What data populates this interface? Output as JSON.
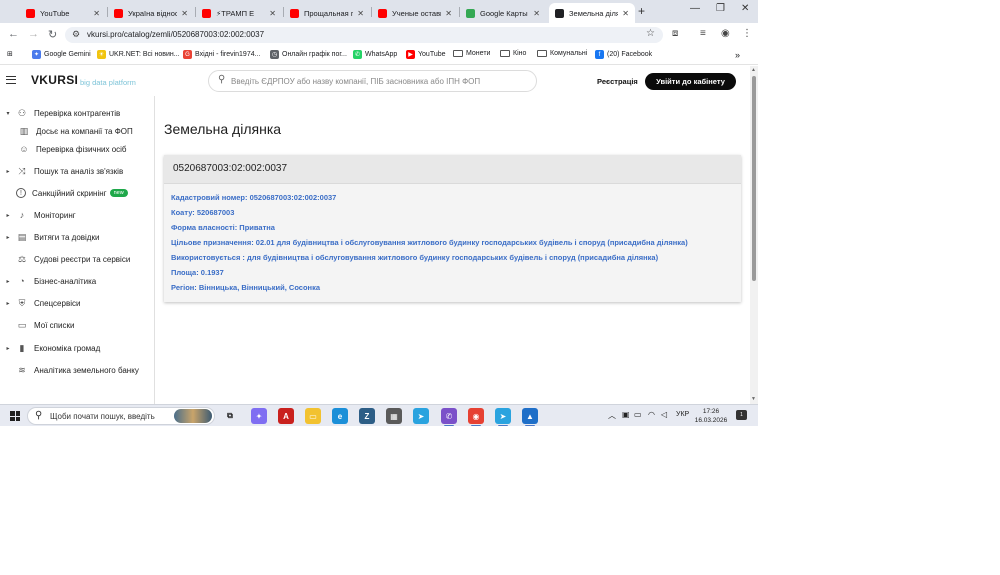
{
  "browser": {
    "tabs": [
      {
        "title": "YouTube",
        "color": "#ff0000",
        "active": false
      },
      {
        "title": "Україна відносл",
        "color": "#ff0000",
        "active": false
      },
      {
        "title": "⚡ТРАМП Е",
        "color": "#ff0000",
        "active": false
      },
      {
        "title": "Прощальная гал",
        "color": "#ff0000",
        "active": false
      },
      {
        "title": "Ученые оставил",
        "color": "#ff0000",
        "active": false
      },
      {
        "title": "Google Карты",
        "color": "#34a853",
        "active": false
      },
      {
        "title": "Земельна ділян",
        "color": "#202124",
        "active": true
      }
    ],
    "new_tab": "+",
    "window_controls": {
      "minimize": "—",
      "restore": "❐",
      "close": "✕"
    },
    "url": "vkursi.pro/catalog/zemli/0520687003:02:002:0037",
    "bookmarks": [
      {
        "label": "Google Gemini",
        "icon": "gemini-icon"
      },
      {
        "label": "UKR.NET: Всі новин...",
        "icon": "ukrnet-icon"
      },
      {
        "label": "Вхідні - firevin1974...",
        "icon": "google-icon"
      },
      {
        "label": "Онлайн графік пог...",
        "icon": "calendar-icon"
      },
      {
        "label": "WhatsApp",
        "icon": "whatsapp-icon"
      },
      {
        "label": "YouTube",
        "icon": "youtube-icon"
      },
      {
        "label": "Монети",
        "icon": "folder-icon"
      },
      {
        "label": "Кіно",
        "icon": "folder-icon"
      },
      {
        "label": "Комунальні",
        "icon": "folder-icon"
      },
      {
        "label": "(20) Facebook",
        "icon": "facebook-icon"
      }
    ],
    "bookmarks_more": "»"
  },
  "site": {
    "logo": "VKURSI",
    "logo_sub": "big data platform",
    "search_placeholder": "Введіть ЄДРПОУ або назву компанії, ПІБ засновника або ІПН ФОП",
    "register": "Реєстрація",
    "login": "Увійти до кабінету"
  },
  "sidebar": {
    "items": [
      {
        "label": "Перевірка контрагентів",
        "icon": "network-icon",
        "caret": "▾",
        "sub": false
      },
      {
        "label": "Досьє на компанії та ФОП",
        "icon": "building-icon",
        "caret": "",
        "sub": true
      },
      {
        "label": "Перевірка фізичних осіб",
        "icon": "person-icon",
        "caret": "",
        "sub": true
      },
      {
        "label": "Пошук та аналіз зв'язків",
        "icon": "links-icon",
        "caret": "▸",
        "sub": false
      },
      {
        "label": "Санкційний скринінг",
        "icon": "alert-icon",
        "caret": "",
        "sub": false,
        "badge": "new"
      },
      {
        "label": "Моніторинг",
        "icon": "bell-icon",
        "caret": "▸",
        "sub": false
      },
      {
        "label": "Витяги та довідки",
        "icon": "chart-icon",
        "caret": "▸",
        "sub": false
      },
      {
        "label": "Судові реєстри та сервіси",
        "icon": "court-icon",
        "caret": "",
        "sub": false
      },
      {
        "label": "Бізнес-аналітика",
        "icon": "analytics-icon",
        "caret": "▸",
        "sub": false
      },
      {
        "label": "Спецсервіси",
        "icon": "shield-icon",
        "caret": "▸",
        "sub": false
      },
      {
        "label": "Мої списки",
        "icon": "folder-icon",
        "caret": "",
        "sub": false
      },
      {
        "label": "Економіка громад",
        "icon": "bars-icon",
        "caret": "▸",
        "sub": false
      },
      {
        "label": "Аналітика земельного банку",
        "icon": "land-icon",
        "caret": "",
        "sub": false
      }
    ]
  },
  "main": {
    "title": "Земельна ділянка",
    "card": {
      "header": "0520687003:02:002:0037",
      "rows": [
        "Кадастровий номер: 0520687003:02:002:0037",
        "Коату: 520687003",
        "Форма власності: Приватна",
        "Цільове призначення: 02.01 для будівництва і обслуговування житлового будинку господарських будівель і споруд (присадибна ділянка)",
        "Використовується : для будівництва і обслуговування житлового будинку господарських будівель і споруд (присадибна ділянка)",
        "Площа: 0.1937",
        "Регіон: Вінницька, Вінницький, Сосонка"
      ]
    }
  },
  "taskbar": {
    "search_placeholder": "Щоби почати пошук, введіть",
    "apps": [
      {
        "name": "taskview-icon",
        "color": "#e7eaf2",
        "label": "⧉"
      },
      {
        "name": "copilot-icon",
        "color": "#7f6ef2",
        "label": "✦"
      },
      {
        "name": "pdf-icon",
        "color": "#c9211e",
        "label": "A"
      },
      {
        "name": "explorer-icon",
        "color": "#f2c230",
        "label": "▭"
      },
      {
        "name": "edge-icon",
        "color": "#1b8fd8",
        "label": "e"
      },
      {
        "name": "z-app-icon",
        "color": "#2d5e86",
        "label": "Z"
      },
      {
        "name": "calculator-icon",
        "color": "#5a5a5a",
        "label": "▦"
      },
      {
        "name": "telegram-icon",
        "color": "#2aa3df",
        "label": "➤"
      },
      {
        "name": "viber-icon",
        "color": "#7b51c9",
        "label": "✆"
      },
      {
        "name": "chrome-icon",
        "color": "#e64133",
        "label": "◉"
      },
      {
        "name": "telegram-2-icon",
        "color": "#2aa3df",
        "label": "➤"
      },
      {
        "name": "photos-icon",
        "color": "#1f6fc8",
        "label": "▲"
      }
    ],
    "lang": "УКР",
    "time": "17:26",
    "date": "16.03.2026",
    "notifications": "1"
  }
}
